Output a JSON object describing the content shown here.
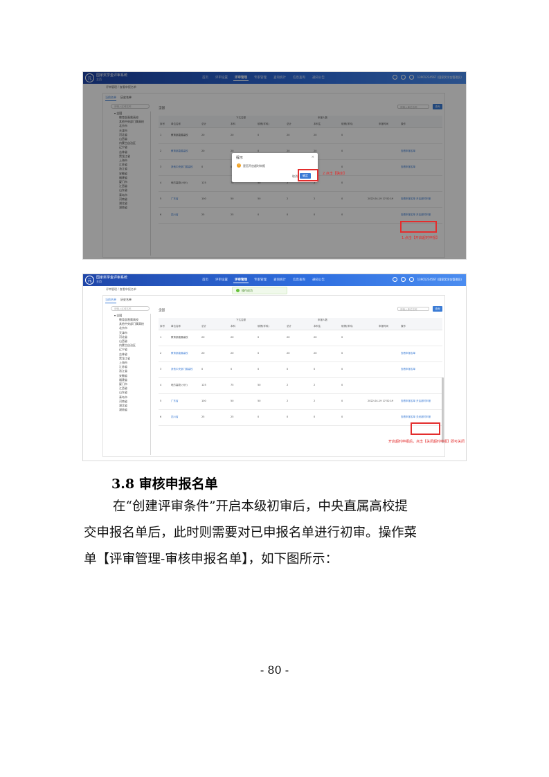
{
  "app": {
    "logo_glyph": "元",
    "title": "国家奖学金评审系统",
    "subtitle": "主页",
    "nav": [
      "首页",
      "评审设置",
      "评审管理",
      "专家管理",
      "查询统计",
      "信息查询",
      "通知公告"
    ],
    "user": "13901234567 (国家奖学金管理员)",
    "breadcrumb": "评审管理 / 查看申报名单",
    "subtabs": [
      "当前名单",
      "历史名单"
    ],
    "tree_search_placeholder": "请输入区域名称",
    "tree_root": "全国",
    "tree_items": [
      "教育部直属高校",
      "其他中央部门属高校",
      "北京市",
      "天津市",
      "河北省",
      "山西省",
      "内蒙古自治区",
      "辽宁省",
      "吉林省",
      "黑龙江省",
      "上海市",
      "江苏省",
      "浙江省",
      "安徽省",
      "福建省",
      "厦门市",
      "江西省",
      "山东省",
      "青岛市",
      "河南省",
      "湖北省",
      "湖南省"
    ],
    "region": "全国",
    "unit_placeholder": "请输入单位名称",
    "query_button": "查询"
  },
  "table": {
    "group1": "下达名额",
    "group2": "申报人数",
    "headers": [
      "序号",
      "单位名称",
      "总计",
      "本科",
      "硕博(学科)",
      "总计",
      "本科生",
      "硕博(学科)",
      "申报时间",
      "操作"
    ],
    "rows": [
      {
        "no": "1",
        "unit": "教育部直属高校",
        "c1": "20",
        "c2": "20",
        "c3": "0",
        "c4": "20",
        "c5": "20",
        "c6": "0",
        "time": "",
        "op": ""
      },
      {
        "no": "2",
        "unit": "教育部直属高校",
        "c1": "20",
        "c2": "20",
        "c3": "0",
        "c4": "20",
        "c5": "20",
        "c6": "0",
        "time": "",
        "op": "查看申报名单"
      },
      {
        "no": "3",
        "unit": "其他中央部门属高校",
        "c1": "0",
        "c2": "0",
        "c3": "0",
        "c4": "0",
        "c5": "0",
        "c6": "0",
        "time": "",
        "op": "查看申报名单"
      },
      {
        "no": "4",
        "unit": "地方高校(小计)",
        "c1": "125",
        "c2": "75",
        "c3": "50",
        "c4": "2",
        "c5": "2",
        "c6": "0",
        "time": "",
        "op": ""
      },
      {
        "no": "5",
        "unit": "广东省",
        "c1": "100",
        "c2": "50",
        "c3": "50",
        "c4": "2",
        "c5": "2",
        "c6": "0",
        "time": "2022-04-19 17:52:19",
        "op": "查看申报名单  开启超时申报"
      },
      {
        "no": "6",
        "unit": "四川省",
        "c1": "25",
        "c2": "25",
        "c3": "0",
        "c4": "0",
        "c5": "0",
        "c6": "0",
        "time": "",
        "op": "查看申报名单  开启超时申报"
      }
    ]
  },
  "shot1": {
    "dialog_title": "提示",
    "dialog_close": "×",
    "dialog_warn": "!",
    "dialog_message": "是否开启超时申报",
    "dialog_cancel": "取消",
    "dialog_ok": "确定",
    "note_confirm": "2.点击【确定】",
    "note_open": "1.点击【开启超时申报】"
  },
  "shot2": {
    "toast": "操作成功",
    "row6_op": "查看申报名单  关闭超时申报",
    "note_close": "开启超时申报后，点击【关闭超时申报】即可关闭"
  },
  "doc": {
    "heading": "3.8 审核申报名单",
    "paragraph_lines": [
      "在“创建评审条件”开启本级初审后，中央直属高校提",
      "交申报名单后，此时则需要对已申报名单进行初审。操作菜",
      "单【评审管理-审核申报名单】，如下图所示："
    ],
    "page_number": "- 80 -"
  },
  "colors": {
    "accent": "#3a7bd5",
    "header_blue": "#2f6fe0",
    "annotation_red": "#e32d2d"
  }
}
